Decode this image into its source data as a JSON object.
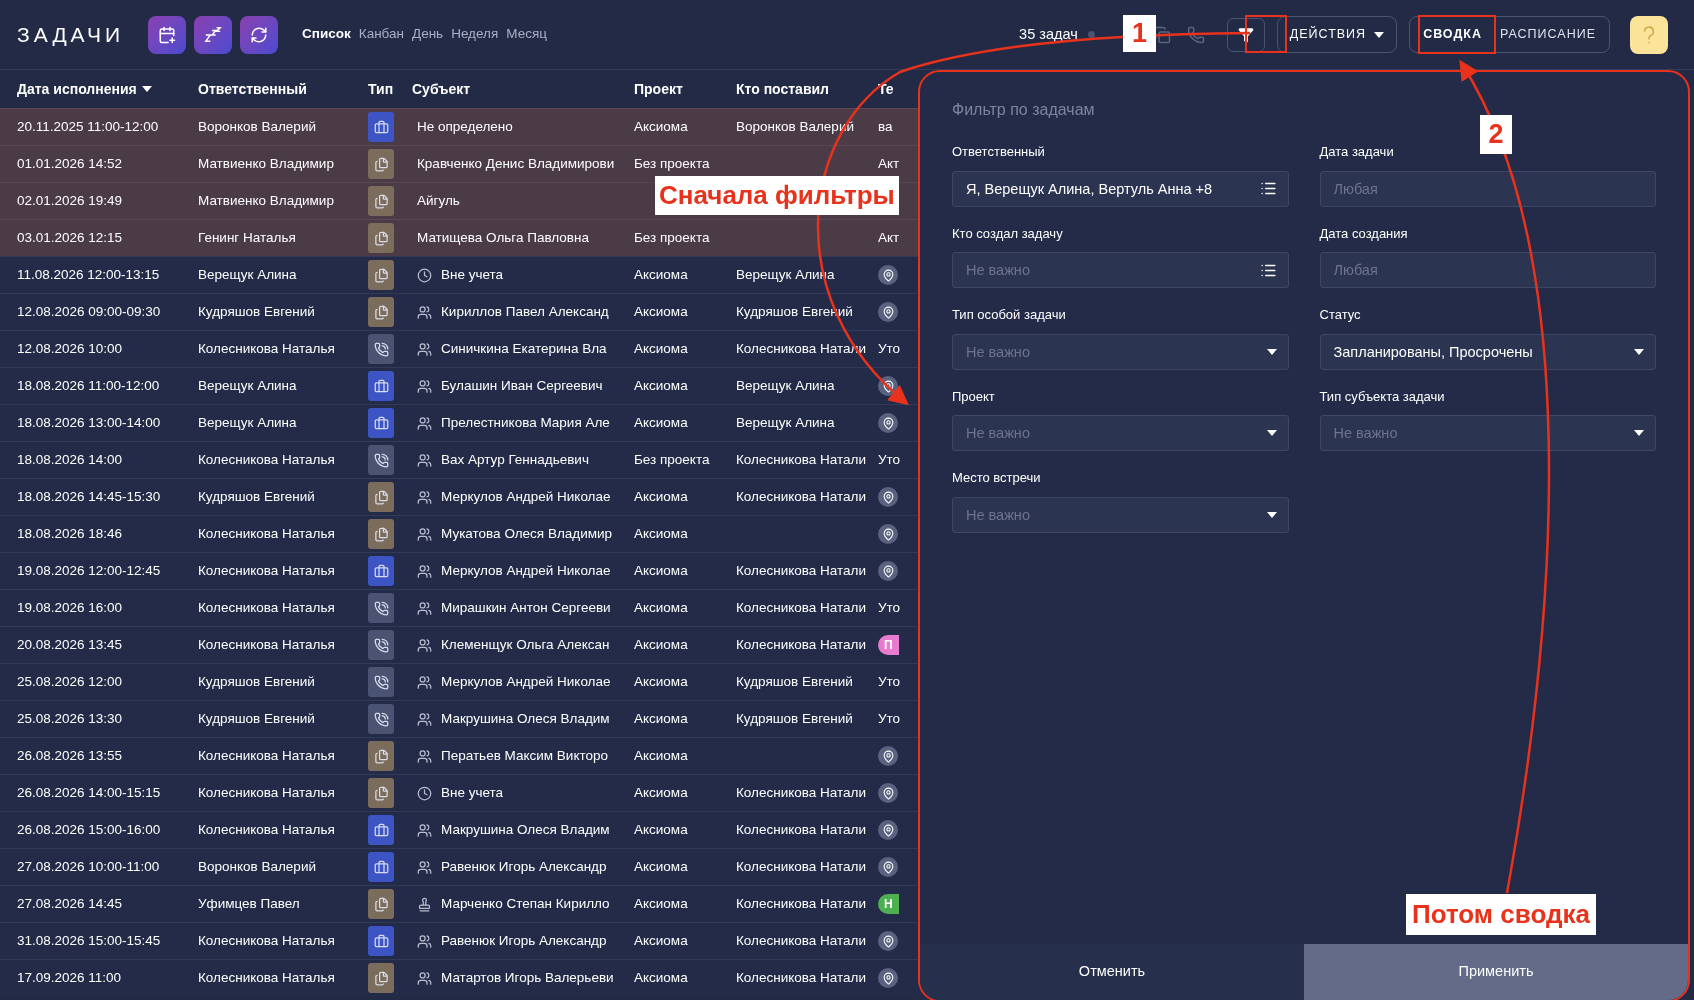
{
  "header": {
    "title": "ЗАДАЧИ",
    "views": [
      {
        "label": "Список",
        "selected": true
      },
      {
        "label": "Канбан",
        "selected": false
      },
      {
        "label": "День",
        "selected": false
      },
      {
        "label": "Неделя",
        "selected": false
      },
      {
        "label": "Месяц",
        "selected": false
      }
    ],
    "count": "35 задач",
    "actions": "ДЕЙСТВИЯ",
    "modes": [
      {
        "label": "СВОДКА",
        "selected": true
      },
      {
        "label": "РАСПИСАНИЕ",
        "selected": false
      }
    ]
  },
  "table": {
    "columns": [
      "Дата исполнения",
      "Ответственный",
      "Тип",
      "Субъект",
      "Проект",
      "Кто поставил",
      "Те"
    ],
    "rows": [
      {
        "overdue": true,
        "date": "20.11.2025 11:00-12:00",
        "responsible": "Воронков Валерий",
        "type": {
          "kind": "briefcase"
        },
        "subject": "Не определено",
        "project": "Аксиома",
        "assigned_by": "Воронков Валерий",
        "column_7": {
          "kind": "text",
          "text": "ва"
        }
      },
      {
        "overdue": true,
        "date": "01.01.2026 14:52",
        "responsible": "Матвиенко Владимир",
        "type": {
          "kind": "documents"
        },
        "subject": "Кравченко Денис Владимирови",
        "project": "Без проекта",
        "column_7": {
          "kind": "text",
          "text": "Акт"
        }
      },
      {
        "overdue": true,
        "date": "02.01.2026 19:49",
        "responsible": "Матвиенко Владимир",
        "type": {
          "kind": "documents"
        },
        "subject": "Айгуль"
      },
      {
        "overdue": true,
        "date": "03.01.2026 12:15",
        "responsible": "Генинг Наталья",
        "type": {
          "kind": "documents"
        },
        "subject": "Матищева Ольга Павловна",
        "project": "Без проекта",
        "column_7": {
          "kind": "text",
          "text": "Акт"
        }
      },
      {
        "overdue": false,
        "date": "11.08.2026 12:00-13:15",
        "responsible": "Верещук Алина",
        "type": {
          "kind": "documents"
        },
        "subject_icon": {
          "kind": "clock"
        },
        "subject": "Вне учета",
        "project": "Аксиома",
        "assigned_by": "Верещук Алина",
        "column_7": {
          "kind": "pin"
        }
      },
      {
        "overdue": false,
        "date": "12.08.2026 09:00-09:30",
        "responsible": "Кудряшов Евгений",
        "type": {
          "kind": "documents"
        },
        "subject_icon": {
          "kind": "people"
        },
        "subject": "Кириллов Павел Александ",
        "project": "Аксиома",
        "assigned_by": "Кудряшов Евгений",
        "column_7": {
          "kind": "pin"
        }
      },
      {
        "overdue": false,
        "date": "12.08.2026 10:00",
        "responsible": "Колесникова Наталья",
        "type": {
          "kind": "phone"
        },
        "subject_icon": {
          "kind": "people"
        },
        "subject": "Синичкина Екатерина Вла",
        "project": "Аксиома",
        "assigned_by": "Колесникова Натали",
        "column_7": {
          "kind": "text",
          "text": "Уто"
        }
      },
      {
        "overdue": false,
        "date": "18.08.2026 11:00-12:00",
        "responsible": "Верещук Алина",
        "type": {
          "kind": "briefcase"
        },
        "subject_icon": {
          "kind": "people"
        },
        "subject": "Булашин Иван Сергеевич",
        "project": "Аксиома",
        "assigned_by": "Верещук Алина",
        "column_7": {
          "kind": "pin"
        }
      },
      {
        "overdue": false,
        "date": "18.08.2026 13:00-14:00",
        "responsible": "Верещук Алина",
        "type": {
          "kind": "briefcase"
        },
        "subject_icon": {
          "kind": "people"
        },
        "subject": "Прелестникова Мария Але",
        "project": "Аксиома",
        "assigned_by": "Верещук Алина",
        "column_7": {
          "kind": "pin"
        }
      },
      {
        "overdue": false,
        "date": "18.08.2026 14:00",
        "responsible": "Колесникова Наталья",
        "type": {
          "kind": "phone"
        },
        "subject_icon": {
          "kind": "people"
        },
        "subject": "Вах Артур Геннадьевич",
        "project": "Без проекта",
        "assigned_by": "Колесникова Натали",
        "column_7": {
          "kind": "text",
          "text": "Уто"
        }
      },
      {
        "overdue": false,
        "date": "18.08.2026 14:45-15:30",
        "responsible": "Кудряшов Евгений",
        "type": {
          "kind": "documents"
        },
        "subject_icon": {
          "kind": "people"
        },
        "subject": "Меркулов Андрей Николае",
        "project": "Аксиома",
        "assigned_by": "Колесникова Натали",
        "column_7": {
          "kind": "pin"
        }
      },
      {
        "overdue": false,
        "date": "18.08.2026 18:46",
        "responsible": "Колесникова Наталья",
        "type": {
          "kind": "documents"
        },
        "subject_icon": {
          "kind": "people"
        },
        "subject": "Мукатова Олеся Владимир",
        "project": "Аксиома",
        "column_7": {
          "kind": "pin"
        }
      },
      {
        "overdue": false,
        "date": "19.08.2026 12:00-12:45",
        "responsible": "Колесникова Наталья",
        "type": {
          "kind": "briefcase"
        },
        "subject_icon": {
          "kind": "people"
        },
        "subject": "Меркулов Андрей Николае",
        "project": "Аксиома",
        "assigned_by": "Колесникова Натали",
        "column_7": {
          "kind": "pin"
        }
      },
      {
        "overdue": false,
        "date": "19.08.2026 16:00",
        "responsible": "Колесникова Наталья",
        "type": {
          "kind": "phone"
        },
        "subject_icon": {
          "kind": "people"
        },
        "subject": "Мирашкин Антон Сергееви",
        "project": "Аксиома",
        "assigned_by": "Колесникова Натали",
        "column_7": {
          "kind": "text",
          "text": "Уто"
        }
      },
      {
        "overdue": false,
        "date": "20.08.2026 13:45",
        "responsible": "Колесникова Наталья",
        "type": {
          "kind": "phone"
        },
        "subject_icon": {
          "kind": "people"
        },
        "subject": "Клеменщук Ольга Алексан",
        "project": "Аксиома",
        "assigned_by": "Колесникова Натали",
        "column_7": {
          "kind": "badge",
          "text": "П",
          "color": "#e77bd0"
        }
      },
      {
        "overdue": false,
        "date": "25.08.2026 12:00",
        "responsible": "Кудряшов Евгений",
        "type": {
          "kind": "phone"
        },
        "subject_icon": {
          "kind": "people"
        },
        "subject": "Меркулов Андрей Николае",
        "project": "Аксиома",
        "assigned_by": "Кудряшов Евгений",
        "column_7": {
          "kind": "text",
          "text": "Уто"
        }
      },
      {
        "overdue": false,
        "date": "25.08.2026 13:30",
        "responsible": "Кудряшов Евгений",
        "type": {
          "kind": "phone"
        },
        "subject_icon": {
          "kind": "people"
        },
        "subject": "Макрушина Олеся Владим",
        "project": "Аксиома",
        "assigned_by": "Кудряшов Евгений",
        "column_7": {
          "kind": "text",
          "text": "Уто"
        }
      },
      {
        "overdue": false,
        "date": "26.08.2026 13:55",
        "responsible": "Колесникова Наталья",
        "type": {
          "kind": "documents"
        },
        "subject_icon": {
          "kind": "people"
        },
        "subject": "Ператьев Максим Викторо",
        "project": "Аксиома",
        "column_7": {
          "kind": "pin"
        }
      },
      {
        "overdue": false,
        "date": "26.08.2026 14:00-15:15",
        "responsible": "Колесникова Наталья",
        "type": {
          "kind": "documents"
        },
        "subject_icon": {
          "kind": "clock"
        },
        "subject": "Вне учета",
        "project": "Аксиома",
        "assigned_by": "Колесникова Натали",
        "column_7": {
          "kind": "pin"
        }
      },
      {
        "overdue": false,
        "date": "26.08.2026 15:00-16:00",
        "responsible": "Колесникова Наталья",
        "type": {
          "kind": "briefcase"
        },
        "subject_icon": {
          "kind": "people"
        },
        "subject": "Макрушина Олеся Владим",
        "project": "Аксиома",
        "assigned_by": "Колесникова Натали",
        "column_7": {
          "kind": "pin"
        }
      },
      {
        "overdue": false,
        "date": "27.08.2026 10:00-11:00",
        "responsible": "Воронков Валерий",
        "type": {
          "kind": "briefcase"
        },
        "subject_icon": {
          "kind": "people"
        },
        "subject": "Равенюк Игорь Александр",
        "project": "Аксиома",
        "assigned_by": "Колесникова Натали",
        "column_7": {
          "kind": "pin"
        }
      },
      {
        "overdue": false,
        "date": "27.08.2026 14:45",
        "responsible": "Уфимцев Павел",
        "type": {
          "kind": "documents"
        },
        "subject_icon": {
          "kind": "stamp"
        },
        "subject": "Марченко Степан Кирилло",
        "project": "Аксиома",
        "assigned_by": "Колесникова Натали",
        "column_7": {
          "kind": "badge",
          "text": "Н",
          "color": "#4caf50"
        }
      },
      {
        "overdue": false,
        "date": "31.08.2026 15:00-15:45",
        "responsible": "Колесникова Наталья",
        "type": {
          "kind": "briefcase"
        },
        "subject_icon": {
          "kind": "people"
        },
        "subject": "Равенюк Игорь Александр",
        "project": "Аксиома",
        "assigned_by": "Колесникова Натали",
        "column_7": {
          "kind": "pin"
        }
      },
      {
        "overdue": false,
        "date": "17.09.2026 11:00",
        "responsible": "Колесникова Наталья",
        "type": {
          "kind": "documents"
        },
        "subject_icon": {
          "kind": "people"
        },
        "subject": "Матартов Игорь Валерьеви",
        "project": "Аксиома",
        "assigned_by": "Колесникова Натали",
        "column_7": {
          "kind": "pin"
        }
      }
    ]
  },
  "filter_panel": {
    "title": "Фильтр по задачам",
    "fields": [
      {
        "label": "Ответственный",
        "kind": "list",
        "value": "Я, Верещук Алина, Вертуль Анна +8"
      },
      {
        "label": "Дата задачи",
        "kind": "date",
        "placeholder": "Любая"
      },
      {
        "label": "Кто создал задачу",
        "kind": "list",
        "placeholder": "Не важно"
      },
      {
        "label": "Дата создания",
        "kind": "date",
        "placeholder": "Любая"
      },
      {
        "label": "Тип особой задачи",
        "kind": "select",
        "placeholder": "Не важно"
      },
      {
        "label": "Статус",
        "kind": "select",
        "value": "Запланированы, Просрочены"
      },
      {
        "label": "Проект",
        "kind": "select",
        "placeholder": "Не важно"
      },
      {
        "label": "Тип субъекта задачи",
        "kind": "select",
        "placeholder": "Не важно"
      },
      {
        "label": "Место встречи",
        "kind": "select",
        "placeholder": "Не важно"
      }
    ],
    "buttons": [
      "Отменить",
      "Применить"
    ]
  },
  "annotations": {
    "step_labels": [
      "1",
      "2"
    ],
    "callouts": [
      "Сначала фильтры",
      "Потом сводка"
    ]
  }
}
